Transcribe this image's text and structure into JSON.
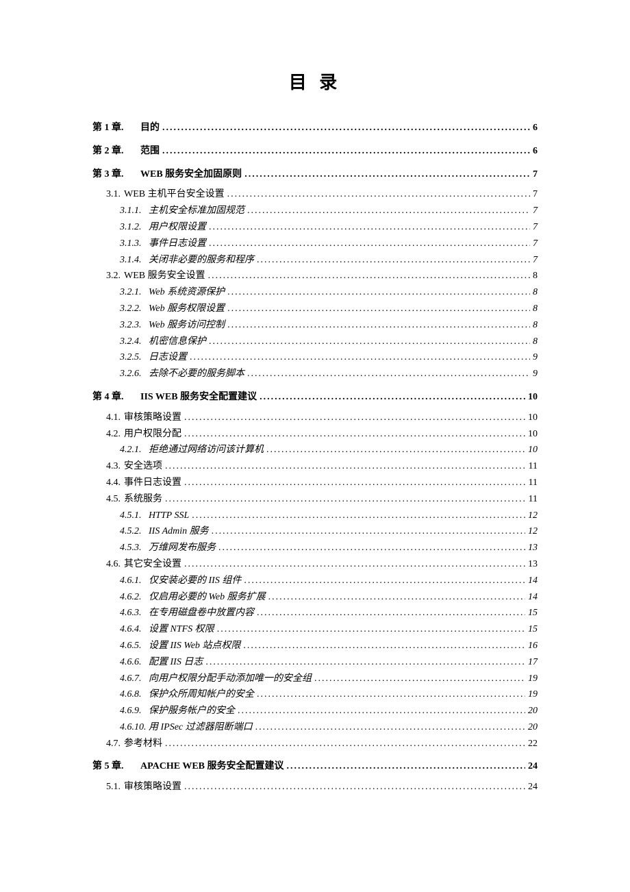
{
  "title": "目 录",
  "entries": [
    {
      "level": "chapter",
      "num": "第 1 章.",
      "text": "目的",
      "page": "6"
    },
    {
      "level": "chapter",
      "num": "第 2 章.",
      "text": "范围",
      "page": "6"
    },
    {
      "level": "chapter",
      "num": "第 3 章.",
      "text": "WEB 服务安全加固原则",
      "page": "7"
    },
    {
      "level": "l1",
      "num": "3.1.",
      "text": "WEB 主机平台安全设置",
      "page": "7",
      "sc": true
    },
    {
      "level": "l2",
      "num": "3.1.1.",
      "text": "主机安全标准加固规范",
      "page": "7"
    },
    {
      "level": "l2",
      "num": "3.1.2.",
      "text": "用户权限设置",
      "page": "7"
    },
    {
      "level": "l2",
      "num": "3.1.3.",
      "text": "事件日志设置",
      "page": "7"
    },
    {
      "level": "l2",
      "num": "3.1.4.",
      "text": "关闭非必要的服务和程序",
      "page": "7"
    },
    {
      "level": "l1",
      "num": "3.2.",
      "text": "WEB 服务安全设置",
      "page": "8",
      "sc": true
    },
    {
      "level": "l2",
      "num": "3.2.1.",
      "text": "Web 系统资源保护",
      "page": "8"
    },
    {
      "level": "l2",
      "num": "3.2.2.",
      "text": "Web 服务权限设置",
      "page": "8"
    },
    {
      "level": "l2",
      "num": "3.2.3.",
      "text": "Web 服务访问控制",
      "page": "8"
    },
    {
      "level": "l2",
      "num": "3.2.4.",
      "text": "机密信息保护",
      "page": "8"
    },
    {
      "level": "l2",
      "num": "3.2.5.",
      "text": "日志设置",
      "page": "9"
    },
    {
      "level": "l2",
      "num": "3.2.6.",
      "text": "去除不必要的服务脚本",
      "page": "9"
    },
    {
      "level": "chapter",
      "num": "第 4 章.",
      "text": "IIS WEB 服务安全配置建议",
      "page": "10"
    },
    {
      "level": "l1",
      "num": "4.1.",
      "text": "审核策略设置",
      "page": "10"
    },
    {
      "level": "l1",
      "num": "4.2.",
      "text": "用户权限分配",
      "page": "10"
    },
    {
      "level": "l2",
      "num": "4.2.1.",
      "text": "拒绝通过网络访问该计算机",
      "page": "10"
    },
    {
      "level": "l1",
      "num": "4.3.",
      "text": "安全选项",
      "page": "11"
    },
    {
      "level": "l1",
      "num": "4.4.",
      "text": "事件日志设置",
      "page": "11"
    },
    {
      "level": "l1",
      "num": "4.5.",
      "text": "系统服务",
      "page": "11"
    },
    {
      "level": "l2",
      "num": "4.5.1.",
      "text": "HTTP SSL",
      "page": "12"
    },
    {
      "level": "l2",
      "num": "4.5.2.",
      "text": "IIS Admin 服务",
      "page": "12"
    },
    {
      "level": "l2",
      "num": "4.5.3.",
      "text": "万维网发布服务",
      "page": "13"
    },
    {
      "level": "l1",
      "num": "4.6.",
      "text": "其它安全设置",
      "page": "13"
    },
    {
      "level": "l2",
      "num": "4.6.1.",
      "text": "仅安装必要的 IIS 组件",
      "page": "14"
    },
    {
      "level": "l2",
      "num": "4.6.2.",
      "text": "仅启用必要的 Web 服务扩展",
      "page": "14"
    },
    {
      "level": "l2",
      "num": "4.6.3.",
      "text": "在专用磁盘卷中放置内容",
      "page": "15"
    },
    {
      "level": "l2",
      "num": "4.6.4.",
      "text": "设置 NTFS 权限",
      "page": "15"
    },
    {
      "level": "l2",
      "num": "4.6.5.",
      "text": "设置 IIS Web 站点权限",
      "page": "16"
    },
    {
      "level": "l2",
      "num": "4.6.6.",
      "text": "配置 IIS 日志",
      "page": "17"
    },
    {
      "level": "l2",
      "num": "4.6.7.",
      "text": "向用户权限分配手动添加唯一的安全组",
      "page": "19"
    },
    {
      "level": "l2",
      "num": "4.6.8.",
      "text": "保护众所周知帐户的安全",
      "page": "19"
    },
    {
      "level": "l2",
      "num": "4.6.9.",
      "text": "保护服务帐户的安全",
      "page": "20"
    },
    {
      "level": "l2",
      "num": "4.6.10.",
      "text": "用 IPSec 过滤器阻断端口",
      "page": "20"
    },
    {
      "level": "l1",
      "num": "4.7.",
      "text": "参考材料",
      "page": "22"
    },
    {
      "level": "chapter",
      "num": "第 5 章.",
      "text": "APACHE WEB 服务安全配置建议",
      "page": "24"
    },
    {
      "level": "l1",
      "num": "5.1.",
      "text": "审核策略设置",
      "page": "24"
    }
  ]
}
